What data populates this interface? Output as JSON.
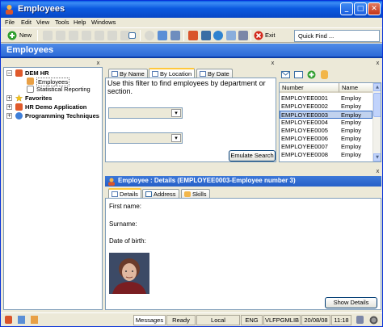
{
  "window": {
    "title": "Employees",
    "min_glyph": "_",
    "max_glyph": "□",
    "close_glyph": "✕"
  },
  "menu": [
    "File",
    "Edit",
    "View",
    "Tools",
    "Help",
    "Windows"
  ],
  "toolbar": {
    "new_label": "New",
    "exit_label": "Exit",
    "quick_find": "Quick Find ..."
  },
  "header_band": "Employees",
  "tree": {
    "close_glyph": "x",
    "items": [
      {
        "label": "DEM HR",
        "expand": "−",
        "bold": true
      },
      {
        "label": "Employees",
        "selected": true
      },
      {
        "label": "Statistical Reporting"
      },
      {
        "label": "Favorites",
        "expand": "+",
        "bold": true
      },
      {
        "label": "HR Demo Application",
        "expand": "+",
        "bold": true
      },
      {
        "label": "Programming Techniques",
        "expand": "+",
        "bold": true
      }
    ]
  },
  "filter": {
    "close_glyph": "x",
    "tabs": [
      "By Name",
      "By Location",
      "By Date"
    ],
    "active_tab": "By Location",
    "description": "Use this filter to find employees by department or section.",
    "combo_arrow": "▾",
    "button": "Emulate Search"
  },
  "list": {
    "close_glyph": "x",
    "columns": [
      "Number",
      "Name"
    ],
    "rows": [
      {
        "number": "EMPLOYEE0001",
        "name": "Employ"
      },
      {
        "number": "EMPLOYEE0002",
        "name": "Employ"
      },
      {
        "number": "EMPLOYEE0003",
        "name": "Employ",
        "selected": true
      },
      {
        "number": "EMPLOYEE0004",
        "name": "Employ"
      },
      {
        "number": "EMPLOYEE0005",
        "name": "Employ"
      },
      {
        "number": "EMPLOYEE0006",
        "name": "Employ"
      },
      {
        "number": "EMPLOYEE0007",
        "name": "Employ"
      },
      {
        "number": "EMPLOYEE0008",
        "name": "Employ"
      }
    ]
  },
  "details": {
    "close_glyph": "x",
    "title": "Employee : Details (EMPLOYEE0003-Employee number 3)",
    "tabs": [
      "Details",
      "Address",
      "Skills"
    ],
    "active_tab": "Details",
    "fields": [
      "First name:",
      "Surname:",
      "Date of birth:"
    ],
    "button": "Show Details"
  },
  "status": {
    "messages": "Messages",
    "ready": "Ready",
    "local": "Local",
    "lang": "ENG",
    "lib": "VLFPGMLIB",
    "date": "20/08/08",
    "time": "11:18"
  },
  "colors": {
    "titlebar": "#0A5FE4",
    "header_band": "#2D6AD8",
    "selection": "#C1D2EE"
  }
}
